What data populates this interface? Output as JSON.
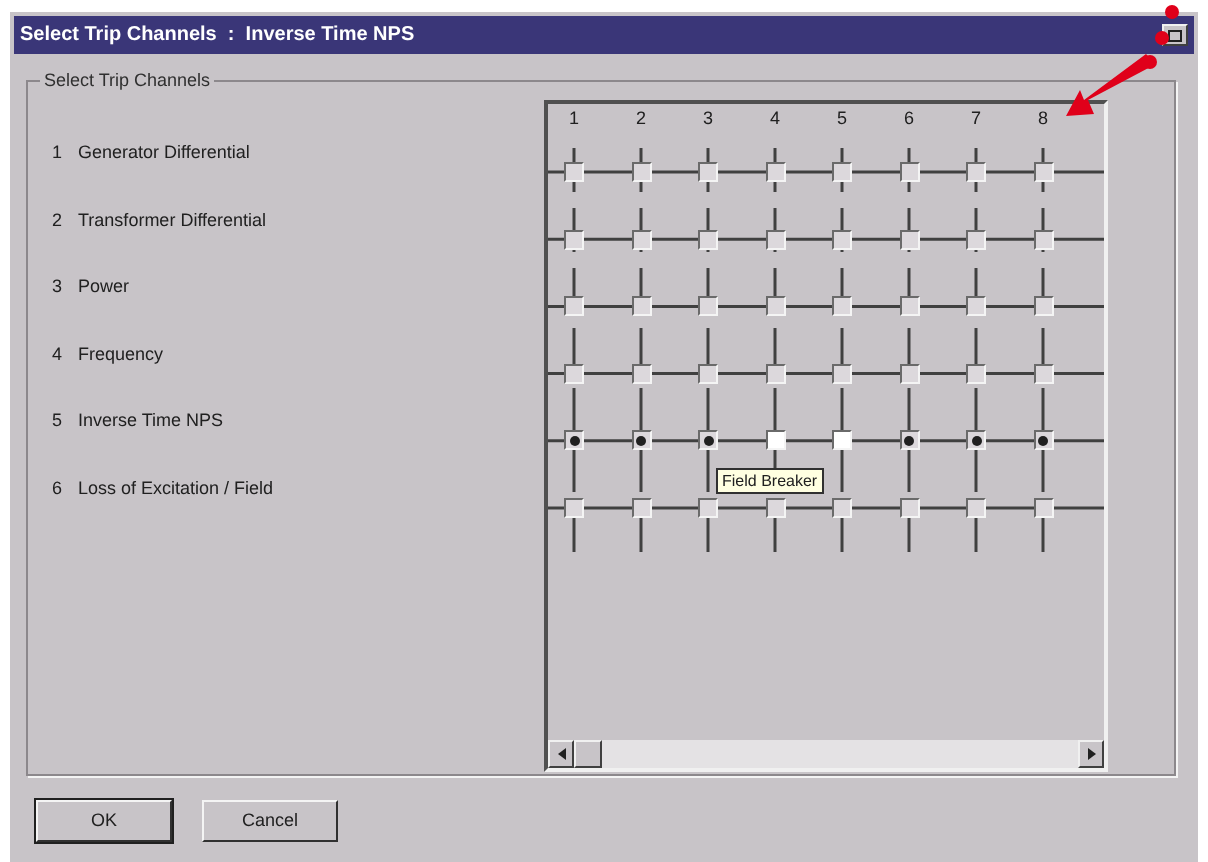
{
  "window": {
    "title": "Select Trip Channels  :  Inverse Time NPS"
  },
  "group": {
    "title": "Select Trip Channels"
  },
  "columns": [
    "1",
    "2",
    "3",
    "4",
    "5",
    "6",
    "7",
    "8"
  ],
  "rows": [
    {
      "number": "1",
      "label": "Generator Differential",
      "cells": [
        {
          "checked": false,
          "highlighted": false
        },
        {
          "checked": false,
          "highlighted": false
        },
        {
          "checked": false,
          "highlighted": false
        },
        {
          "checked": false,
          "highlighted": false
        },
        {
          "checked": false,
          "highlighted": false
        },
        {
          "checked": false,
          "highlighted": false
        },
        {
          "checked": false,
          "highlighted": false
        },
        {
          "checked": false,
          "highlighted": false
        }
      ]
    },
    {
      "number": "2",
      "label": "Transformer Differential",
      "cells": [
        {
          "checked": false,
          "highlighted": false
        },
        {
          "checked": false,
          "highlighted": false
        },
        {
          "checked": false,
          "highlighted": false
        },
        {
          "checked": false,
          "highlighted": false
        },
        {
          "checked": false,
          "highlighted": false
        },
        {
          "checked": false,
          "highlighted": false
        },
        {
          "checked": false,
          "highlighted": false
        },
        {
          "checked": false,
          "highlighted": false
        }
      ]
    },
    {
      "number": "3",
      "label": "Power",
      "cells": [
        {
          "checked": false,
          "highlighted": false
        },
        {
          "checked": false,
          "highlighted": false
        },
        {
          "checked": false,
          "highlighted": false
        },
        {
          "checked": false,
          "highlighted": false
        },
        {
          "checked": false,
          "highlighted": false
        },
        {
          "checked": false,
          "highlighted": false
        },
        {
          "checked": false,
          "highlighted": false
        },
        {
          "checked": false,
          "highlighted": false
        }
      ]
    },
    {
      "number": "4",
      "label": "Frequency",
      "cells": [
        {
          "checked": false,
          "highlighted": false
        },
        {
          "checked": false,
          "highlighted": false
        },
        {
          "checked": false,
          "highlighted": false
        },
        {
          "checked": false,
          "highlighted": false
        },
        {
          "checked": false,
          "highlighted": false
        },
        {
          "checked": false,
          "highlighted": false
        },
        {
          "checked": false,
          "highlighted": false
        },
        {
          "checked": false,
          "highlighted": false
        }
      ]
    },
    {
      "number": "5",
      "label": "Inverse Time NPS",
      "cells": [
        {
          "checked": true,
          "highlighted": false
        },
        {
          "checked": true,
          "highlighted": false
        },
        {
          "checked": true,
          "highlighted": false
        },
        {
          "checked": false,
          "highlighted": true
        },
        {
          "checked": false,
          "highlighted": true
        },
        {
          "checked": true,
          "highlighted": false
        },
        {
          "checked": true,
          "highlighted": false
        },
        {
          "checked": true,
          "highlighted": false
        }
      ]
    },
    {
      "number": "6",
      "label": "Loss of Excitation / Field",
      "cells": [
        {
          "checked": false,
          "highlighted": false
        },
        {
          "checked": false,
          "highlighted": false
        },
        {
          "checked": false,
          "highlighted": false
        },
        {
          "checked": false,
          "highlighted": false
        },
        {
          "checked": false,
          "highlighted": false
        },
        {
          "checked": false,
          "highlighted": false
        },
        {
          "checked": false,
          "highlighted": false
        },
        {
          "checked": false,
          "highlighted": false
        }
      ]
    }
  ],
  "tooltip": {
    "text": "Field Breaker"
  },
  "buttons": [
    "OK",
    "Cancel"
  ]
}
